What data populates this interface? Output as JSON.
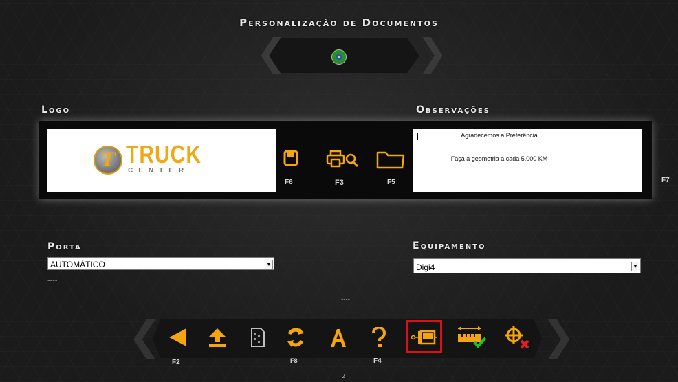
{
  "header": {
    "title": "Personalização de Documentos"
  },
  "language": {
    "icon": "brazil-flag-icon"
  },
  "logo_section": {
    "label": "Logo",
    "logo_word": "TRUCK",
    "logo_sub": "CENTER"
  },
  "actions": {
    "save": {
      "icon": "save-icon",
      "key": "F6"
    },
    "print_preview": {
      "icon": "print-preview-icon",
      "key": "F3"
    },
    "open": {
      "icon": "folder-icon",
      "key": "F5"
    },
    "f7_key": "F7"
  },
  "observations": {
    "label": "Observações",
    "line1": "Agradecemos a Preferência",
    "line2": "Faça a geometria a cada 5.000 KM"
  },
  "port": {
    "label": "Porta",
    "selected": "AUTOMÁTICO",
    "below": "----"
  },
  "equipment": {
    "label": "Equipamento",
    "selected": "Digi4"
  },
  "center_text": "----",
  "toolbar": {
    "items": [
      {
        "icon": "back-arrow-icon",
        "key": "F2"
      },
      {
        "icon": "upload-icon",
        "key": ""
      },
      {
        "icon": "document-icon",
        "key": ""
      },
      {
        "icon": "refresh-icon",
        "key": "F8"
      },
      {
        "icon": "font-icon",
        "key": ""
      },
      {
        "icon": "help-icon",
        "key": "F4"
      },
      {
        "icon": "equipment-config-icon",
        "key": "",
        "active": true
      },
      {
        "icon": "ruler-check-icon",
        "key": ""
      },
      {
        "icon": "target-cancel-icon",
        "key": ""
      }
    ]
  },
  "page_number": "2",
  "colors": {
    "accent": "#f5a60f",
    "highlight": "#e01010",
    "check": "#22c122",
    "cancel": "#e02020"
  }
}
